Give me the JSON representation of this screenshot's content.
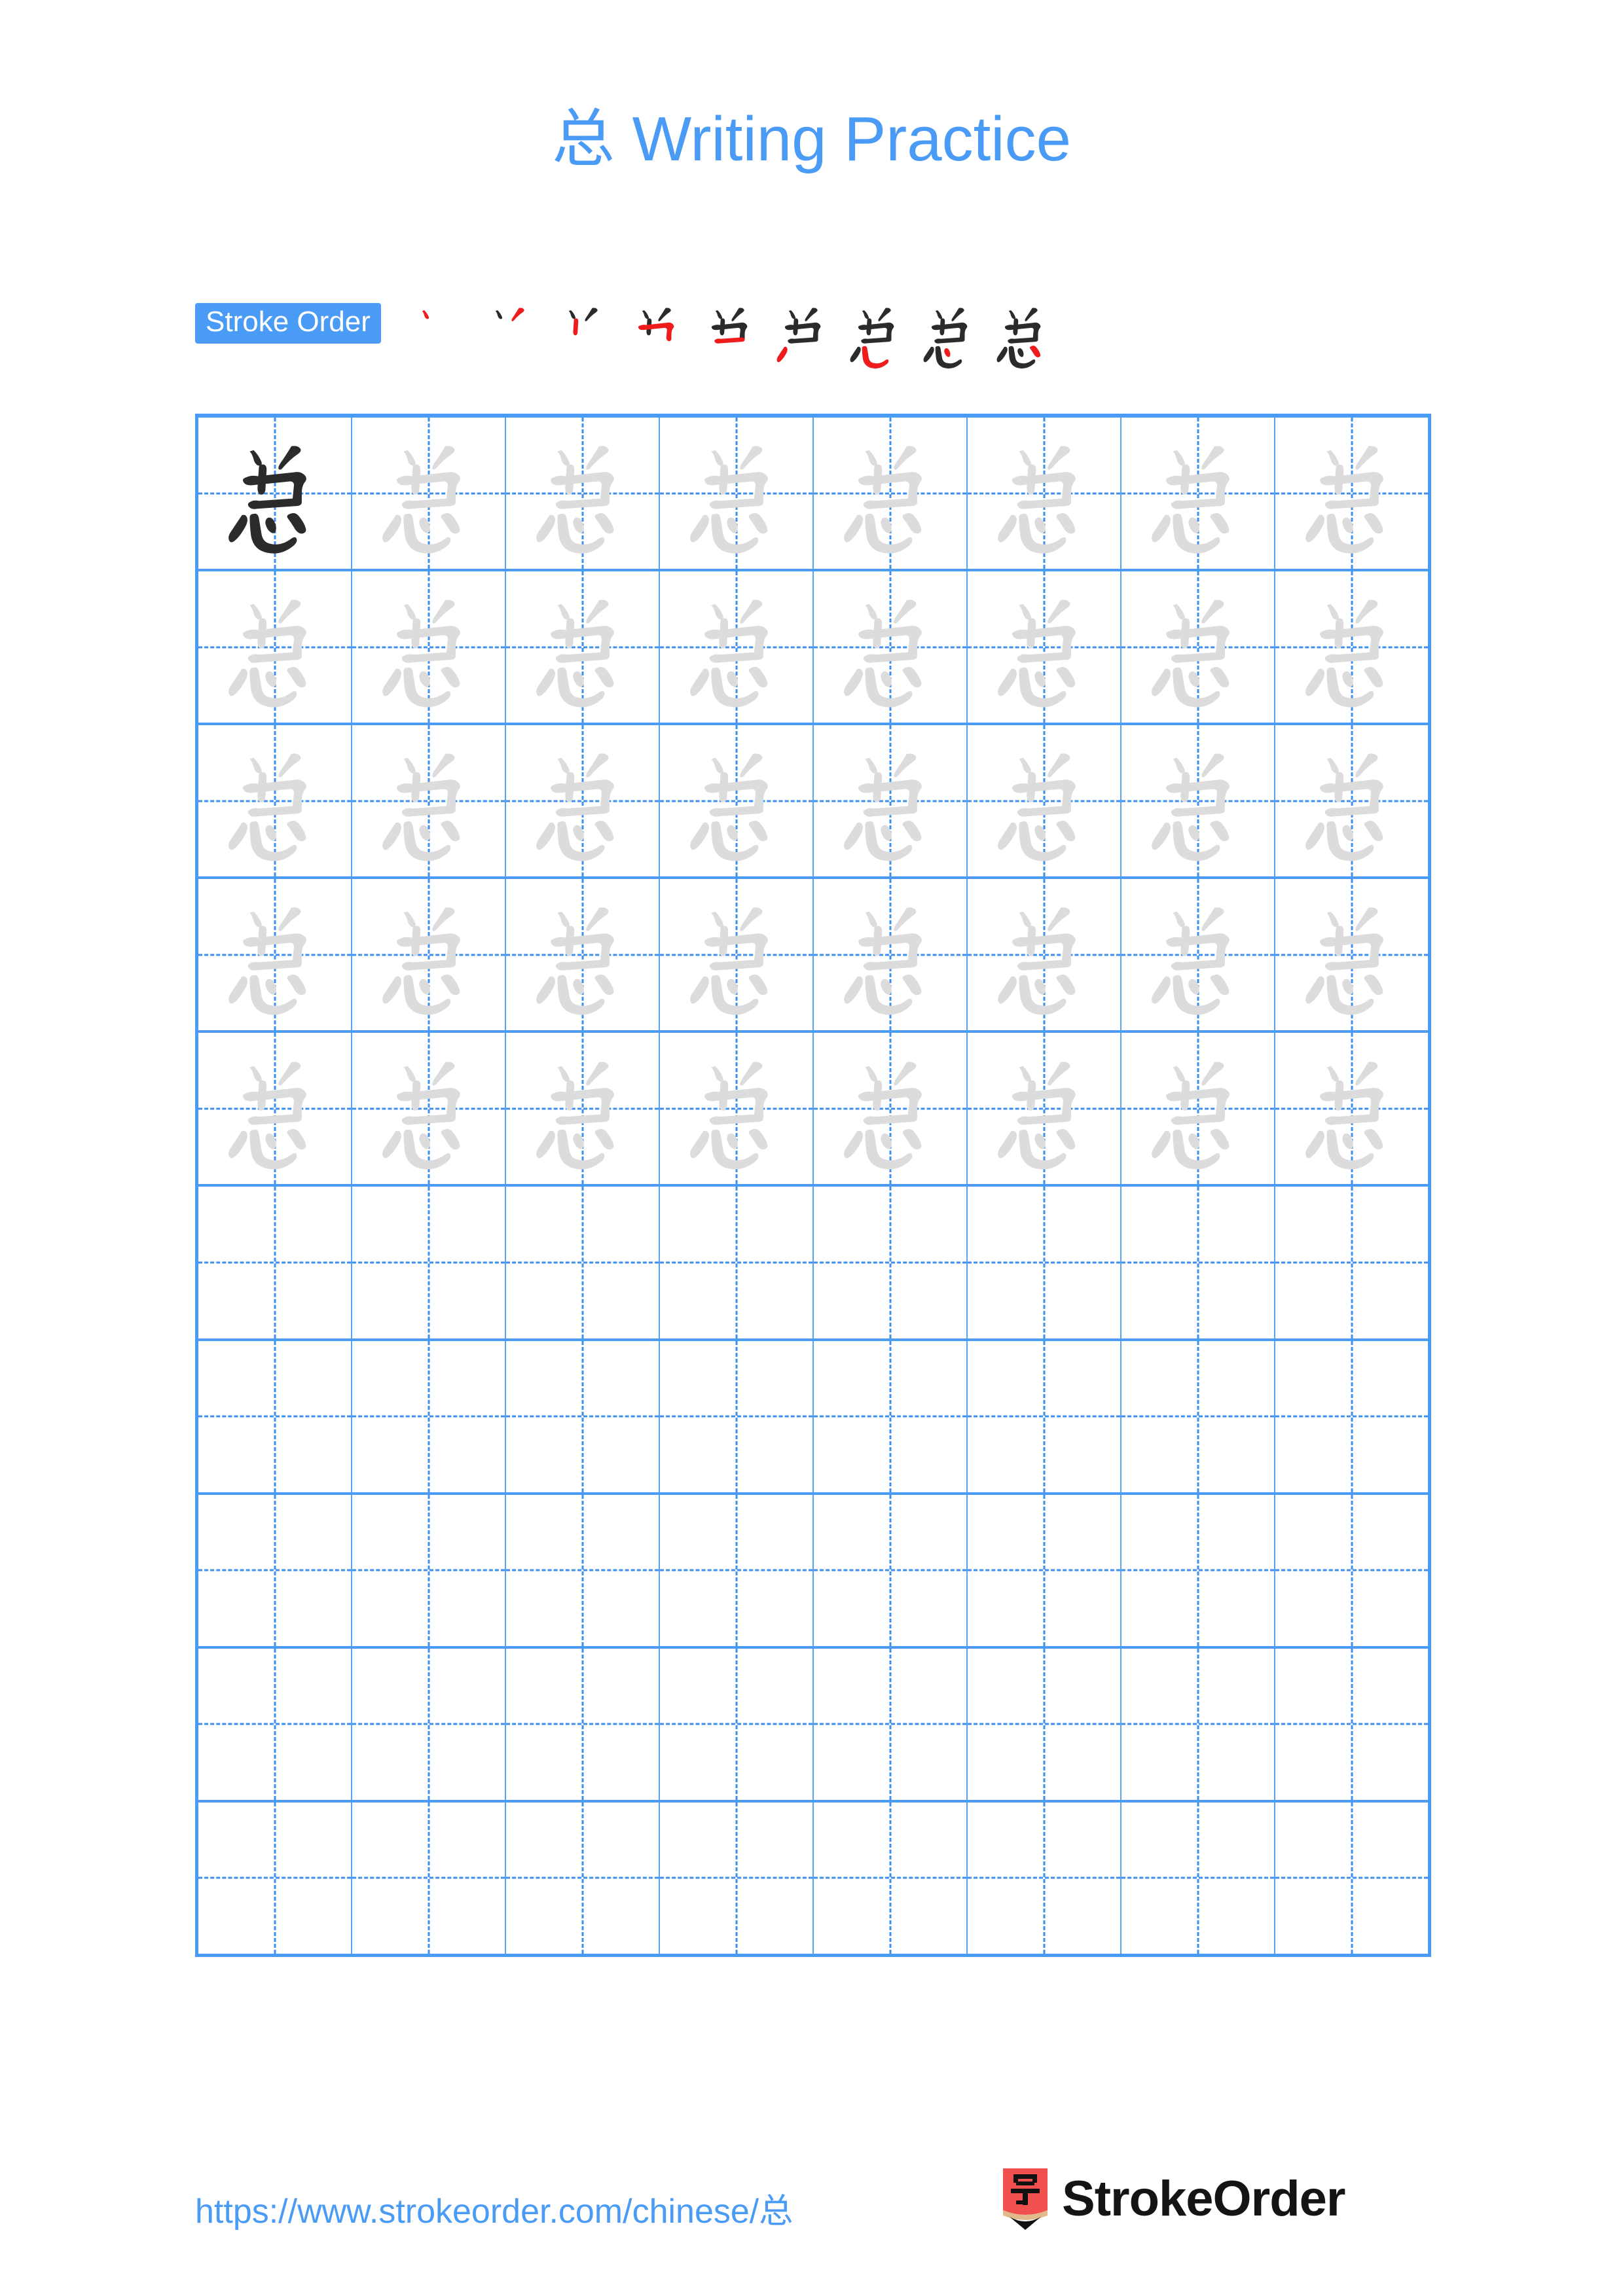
{
  "document": {
    "character": "总",
    "title_suffix": " Writing Practice",
    "title_full": "总 Writing Practice",
    "page_background": "#ffffff"
  },
  "colors": {
    "accent_blue": "#4a9bf5",
    "grid_line": "#4a9bf5",
    "grid_inner_line": "#56a3f2",
    "guide_dash": "#3d8ff0",
    "ghost_gray": "#dcdcdc",
    "ink_black": "#2b2b2b",
    "new_stroke_red": "#ee1c1c",
    "logo_red": "#f0514e",
    "logo_wood": "#e0b98d",
    "logo_tip": "#111111"
  },
  "stroke_order": {
    "badge_label": "Stroke Order",
    "step_count": 9,
    "steps": [
      {
        "index": 1,
        "name": "stroke-step-1",
        "strokes_drawn": 1
      },
      {
        "index": 2,
        "name": "stroke-step-2",
        "strokes_drawn": 2
      },
      {
        "index": 3,
        "name": "stroke-step-3",
        "strokes_drawn": 3
      },
      {
        "index": 4,
        "name": "stroke-step-4",
        "strokes_drawn": 4
      },
      {
        "index": 5,
        "name": "stroke-step-5",
        "strokes_drawn": 5
      },
      {
        "index": 6,
        "name": "stroke-step-6",
        "strokes_drawn": 6
      },
      {
        "index": 7,
        "name": "stroke-step-7",
        "strokes_drawn": 7
      },
      {
        "index": 8,
        "name": "stroke-step-8",
        "strokes_drawn": 8
      },
      {
        "index": 9,
        "name": "stroke-step-9",
        "strokes_drawn": 9
      }
    ]
  },
  "grid": {
    "columns": 8,
    "rows": 10,
    "rows_with_glyphs": 5,
    "rows_empty": 5,
    "first_cell_style": "dark",
    "other_filled_cell_style": "ghost",
    "guide_style": "dashed-cross"
  },
  "footer": {
    "url": "https://www.strokeorder.com/chinese/总",
    "brand_name": "StrokeOrder",
    "logo_character": "字"
  }
}
